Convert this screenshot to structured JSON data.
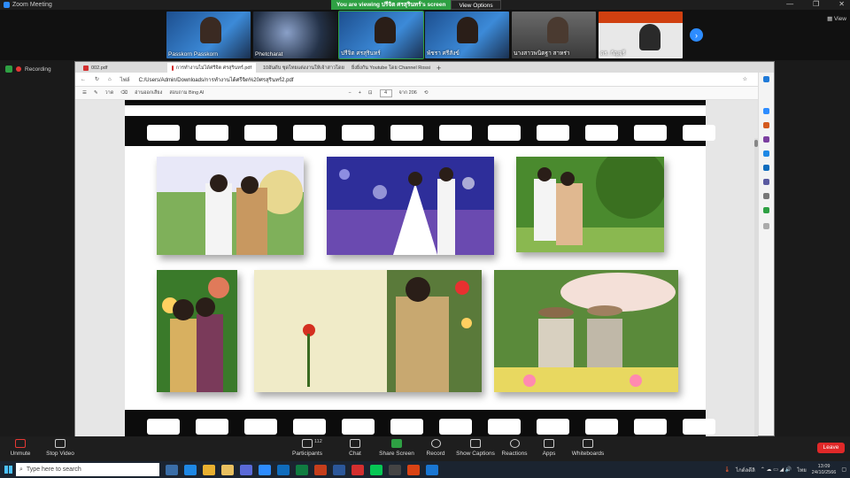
{
  "window": {
    "title": "Zoom Meeting",
    "controls": [
      "—",
      "❐",
      "✕"
    ]
  },
  "share_banner": {
    "text": "You are viewing ปรีจิต ศรสุรินทร์'s screen",
    "view_options": "View Options"
  },
  "gallery": {
    "participants": [
      {
        "name": "Passkorn Passkorn"
      },
      {
        "name": "Phetcharat"
      },
      {
        "name": "ปรีจิต ศรสุรินทร์"
      },
      {
        "name": "พัชรา ศรีสังข์"
      },
      {
        "name": "นางสาวพนิตฐา สาหร่า"
      },
      {
        "name": "ดร. กัญจุรี"
      }
    ],
    "next_icon": "chevron-right-icon",
    "view_label": "View"
  },
  "recording": {
    "label": "Recording"
  },
  "browser": {
    "tabs": [
      {
        "title": "002.pdf",
        "color": "#d32f2f"
      },
      {
        "title": "การทำงานไม่ได้ศรีจิต ศรสุรินทร์.pdf",
        "color": "#d32f2f"
      },
      {
        "title": "10อันดับ ชุดไทยแต่งงานให้เจ้าสาวโดยทัว",
        "color": "#888888"
      },
      {
        "title": "ยิ่งยิ่งกัน Youtube โดย Channel Rossi",
        "color": "#d32f2f"
      }
    ],
    "address": {
      "info": "ไฟล์",
      "url": "C:/Users/Admin/Downloads/การทำงานได้ศรีจิต%20ศรสุรินทร์2.pdf"
    },
    "pdf_toolbar": {
      "draw": "วาด",
      "read_aloud": "อ่านออกเสียง",
      "ask": "สอบถาม Bing AI",
      "page": "4",
      "of": "จาก 206",
      "zoom_minus": "−",
      "zoom_plus": "+"
    }
  },
  "pdf_page": {
    "photos": [
      {
        "name": "photo-couple-thai-ceremony",
        "palette": [
          "#6a9e4a",
          "#e8f0ff",
          "#b59a5a"
        ]
      },
      {
        "name": "photo-couple-stage-bubbles",
        "palette": [
          "#2b2b8f",
          "#b8b8ff",
          "#ffffff"
        ]
      },
      {
        "name": "photo-couple-garden",
        "palette": [
          "#3f7a2a",
          "#9dc06a",
          "#e8c7a0"
        ]
      },
      {
        "name": "photo-couple-flowers",
        "palette": [
          "#2e6a2a",
          "#e07a5a",
          "#d8b060"
        ]
      },
      {
        "name": "photo-hands-rose",
        "palette": [
          "#e8e0b0",
          "#c8a870",
          "#7a5a3a"
        ]
      },
      {
        "name": "photo-couple-cowboy-hats",
        "palette": [
          "#5a8a3a",
          "#b89a70",
          "#ff8ab0"
        ]
      }
    ]
  },
  "controls": {
    "unmute": "Unmute",
    "stop_video": "Stop Video",
    "participants": "Participants",
    "participants_count": "112",
    "chat": "Chat",
    "share_screen": "Share Screen",
    "record": "Record",
    "captions": "Show Captions",
    "reactions": "Reactions",
    "apps": "Apps",
    "whiteboards": "Whiteboards",
    "leave": "Leave"
  },
  "taskbar": {
    "search": "Type here to search",
    "weather": "ไกด์ลดีลิ",
    "lang": "ไทย",
    "time": "13:09",
    "date": "24/10/2566"
  },
  "colors": {
    "zoom_blue": "#2d8cff",
    "leave_red": "#e02828",
    "share_green": "#2ea043"
  }
}
